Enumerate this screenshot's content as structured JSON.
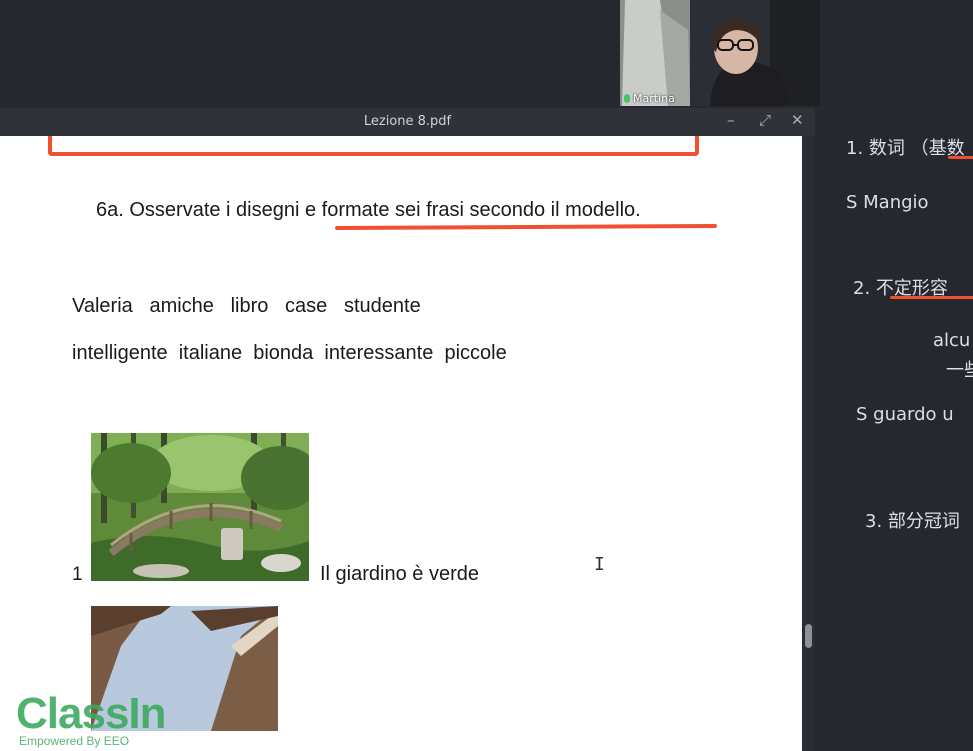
{
  "pdf_window": {
    "title": "Lezione 8.pdf",
    "controls": {
      "minimize": "–",
      "restore": "⤢",
      "close": "✕"
    }
  },
  "video": {
    "participant_name": "Martina"
  },
  "pdf_page": {
    "instruction": "6a. Osservate i disegni e formate sei frasi secondo il modello.",
    "word_bank_line1": "Valeria   amiche   libro   case   studente",
    "word_bank_line2": "intelligente  italiane  bionda  interessante  piccole",
    "item1_number": "1",
    "item1_caption": "Il giardino è verde"
  },
  "whiteboard": {
    "line1": "1. 数词 （基数",
    "line2": "S     Mangio",
    "line3": "2.  不定形容",
    "line4": "alcu",
    "line5": "一些",
    "line6": "S  guardo u",
    "line7": "3. 部分冠词"
  },
  "logo": {
    "name": "ClassIn",
    "tagline": "Empowered By EEO"
  },
  "colors": {
    "annotation_red": "#f0502f",
    "logo_green": "#3fa95f",
    "app_bg": "#24272c"
  }
}
